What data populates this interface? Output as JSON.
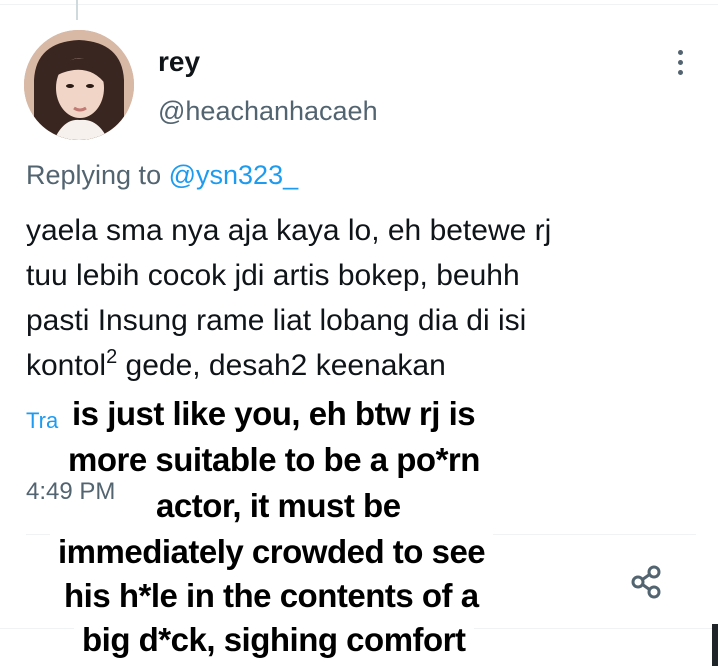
{
  "tweet": {
    "display_name": "rey",
    "handle": "@heachanhacaeh",
    "replying_prefix": "Replying to",
    "replying_to": "@ysn323_",
    "text_line1": "yaela sma nya aja kaya lo, eh betewe rj",
    "text_line2": "tuu lebih cocok jdi artis bokep, beuhh",
    "text_line3": "pasti Insung rame liat lobang dia di isi",
    "text_line4a": "kontol",
    "text_line4_sup": "2",
    "text_line4b": " gede, desah2 keenakan",
    "translate_label": "Tra",
    "timestamp": "4:49 PM"
  },
  "overlay_caption": {
    "lines": [
      "is just like you, eh btw rj is",
      "more suitable to be a po*rn",
      "actor, it must be",
      "immediately crowded to see",
      "his h*le in the contents of a",
      "big d*ck, sighing comfort"
    ]
  },
  "icons": {
    "more": "more-vertical-icon",
    "share": "share-icon"
  },
  "colors": {
    "link": "#1d9bf0",
    "secondary_text": "#536471",
    "primary_text": "#0f1419"
  }
}
